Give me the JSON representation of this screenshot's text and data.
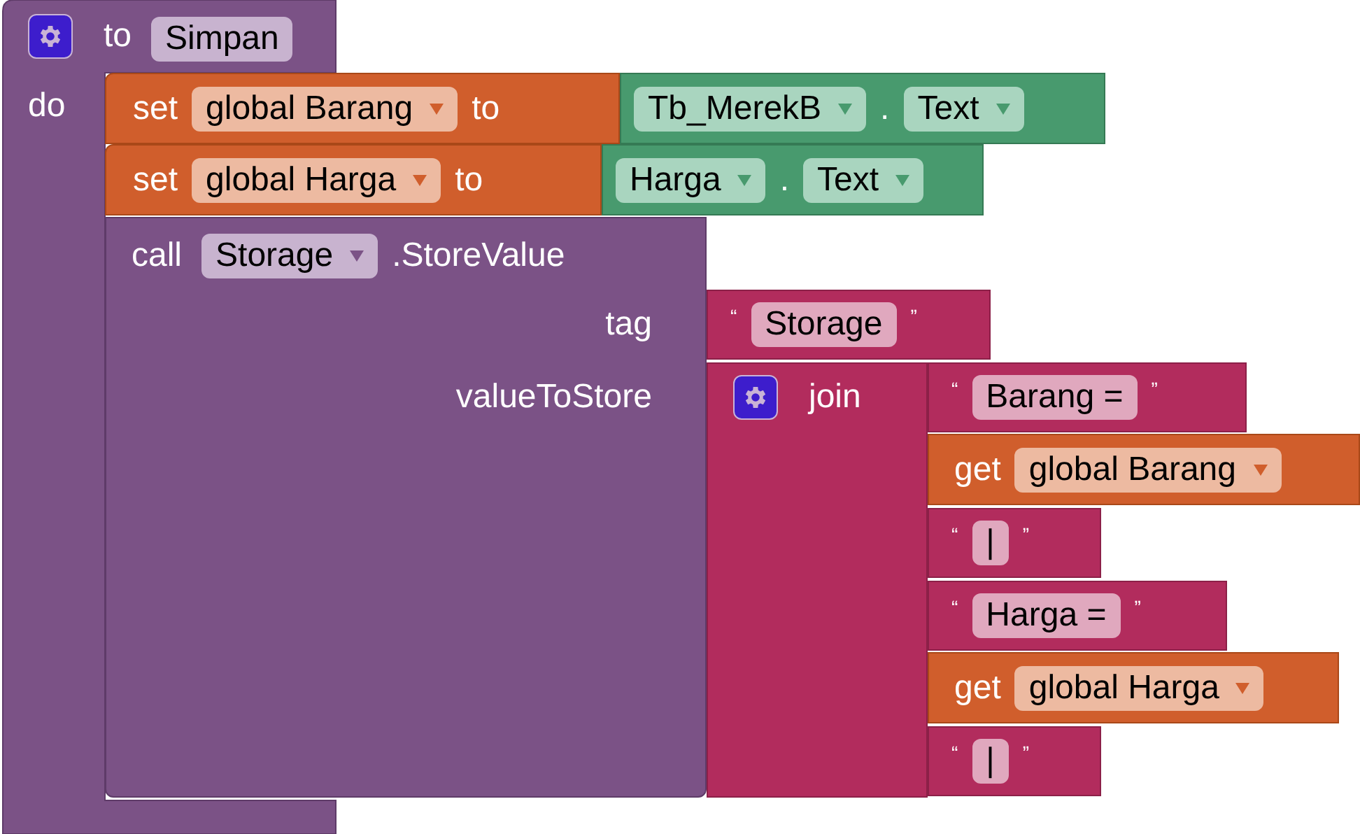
{
  "procedure": {
    "keyword": "to",
    "name": "Simpan",
    "do_label": "do",
    "statements": [
      {
        "kind": "set",
        "keyword": "set",
        "variable": "global Barang",
        "to": "to",
        "value": {
          "component": "Tb_MerekB",
          "dot": ".",
          "property": "Text"
        }
      },
      {
        "kind": "set",
        "keyword": "set",
        "variable": "global Harga",
        "to": "to",
        "value": {
          "component": "Harga",
          "dot": ".",
          "property": "Text"
        }
      },
      {
        "kind": "call",
        "keyword": "call",
        "component": "Storage",
        "method": ".StoreValue",
        "args": [
          {
            "label": "tag",
            "value": {
              "kind": "text",
              "open": "“",
              "text": "Storage",
              "close": "”"
            }
          },
          {
            "label": "valueToStore",
            "value": {
              "kind": "join",
              "keyword": "join",
              "items": [
                {
                  "kind": "text",
                  "open": "“",
                  "text": "Barang =",
                  "close": "”"
                },
                {
                  "kind": "get",
                  "keyword": "get",
                  "variable": "global Barang"
                },
                {
                  "kind": "text",
                  "open": "“",
                  "text": "|",
                  "close": "”"
                },
                {
                  "kind": "text",
                  "open": "“",
                  "text": "Harga =",
                  "close": "”"
                },
                {
                  "kind": "get",
                  "keyword": "get",
                  "variable": "global Harga"
                },
                {
                  "kind": "text",
                  "open": "“",
                  "text": "|",
                  "close": "”"
                }
              ]
            }
          }
        ]
      }
    ]
  }
}
